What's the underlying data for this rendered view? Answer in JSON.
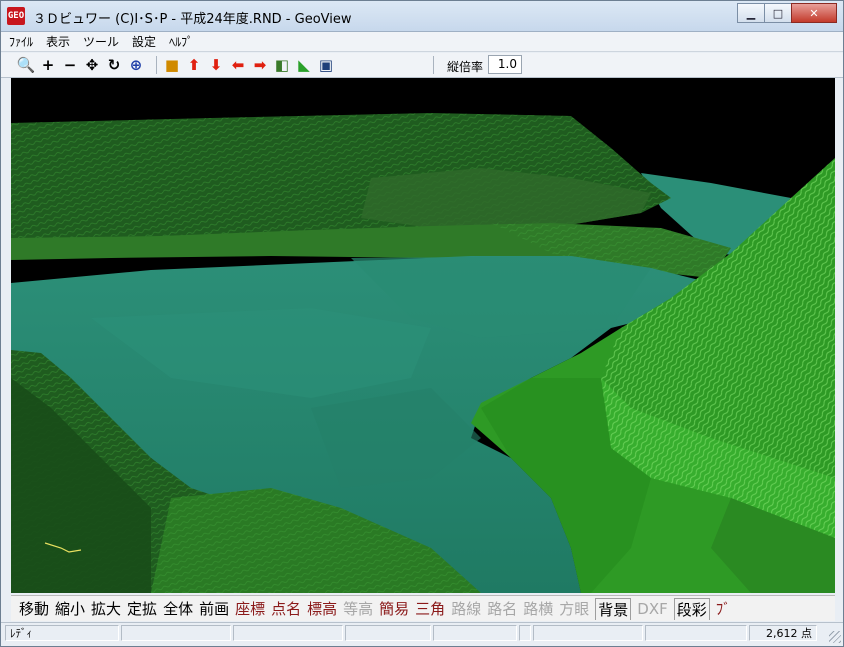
{
  "window": {
    "icon_text": "GEO",
    "title": "３Ｄビュワー (C)I･S･P - 平成24年度.RND - GeoView",
    "minimize_label": "▁",
    "maximize_label": "□",
    "close_label": "✕"
  },
  "menu": [
    "ﾌｧｲﾙ",
    "表示",
    "ツール",
    "設定",
    "ﾍﾙﾌﾟ"
  ],
  "toolbar": {
    "tools": [
      {
        "name": "zoom-search-icon",
        "glyph": "🔍",
        "color": "#b22222"
      },
      {
        "name": "plus-icon",
        "glyph": "+",
        "color": "#000000"
      },
      {
        "name": "minus-icon",
        "glyph": "−",
        "color": "#000000"
      },
      {
        "name": "move-arrows-icon",
        "glyph": "✥",
        "color": "#000000"
      },
      {
        "name": "rotate-icon",
        "glyph": "↻",
        "color": "#000000"
      },
      {
        "name": "zoom-fit-icon",
        "glyph": "⊕",
        "color": "#1f3fa8"
      }
    ],
    "view_tools": [
      {
        "name": "cube-icon",
        "glyph": "■",
        "color": "#d08a00"
      },
      {
        "name": "arrow-up-icon",
        "glyph": "⬆",
        "color": "#e02010"
      },
      {
        "name": "arrow-down-icon",
        "glyph": "⬇",
        "color": "#e02010"
      },
      {
        "name": "arrow-left-icon",
        "glyph": "⬅",
        "color": "#e02010"
      },
      {
        "name": "arrow-right-icon",
        "glyph": "➡",
        "color": "#e02010"
      },
      {
        "name": "box-3d-icon",
        "glyph": "◧",
        "color": "#3a7a2a"
      },
      {
        "name": "axes-icon",
        "glyph": "◣",
        "color": "#2aa02a"
      },
      {
        "name": "window-icon",
        "glyph": "▣",
        "color": "#1f3f7a"
      }
    ],
    "vertical_scale_label": "縦倍率",
    "vertical_scale_value": "1.0"
  },
  "commands": [
    {
      "label": "移動",
      "state": "black"
    },
    {
      "label": "縮小",
      "state": "black"
    },
    {
      "label": "拡大",
      "state": "black"
    },
    {
      "label": "定拡",
      "state": "black"
    },
    {
      "label": "全体",
      "state": "black"
    },
    {
      "label": "前画",
      "state": "black"
    },
    {
      "label": "座標",
      "state": "red"
    },
    {
      "label": "点名",
      "state": "red"
    },
    {
      "label": "標高",
      "state": "red"
    },
    {
      "label": "等高",
      "state": "gray"
    },
    {
      "label": "簡易",
      "state": "red"
    },
    {
      "label": "三角",
      "state": "red"
    },
    {
      "label": "路線",
      "state": "gray"
    },
    {
      "label": "路名",
      "state": "gray"
    },
    {
      "label": "路横",
      "state": "gray"
    },
    {
      "label": "方眼",
      "state": "gray"
    },
    {
      "label": "背景",
      "state": "boxed"
    },
    {
      "label": "DXF",
      "state": "gray"
    },
    {
      "label": "段彩",
      "state": "boxed"
    },
    {
      "label": "ﾌﾞ",
      "state": "red"
    }
  ],
  "status": {
    "ready": "ﾚﾃﾞｨ",
    "point_count": "2,612 点"
  },
  "colors": {
    "terrain_dark": "#1f5c1f",
    "terrain_mid": "#2f8a22",
    "terrain_bright": "#36b030",
    "water": "#2a8a72",
    "sky": "#000000"
  }
}
